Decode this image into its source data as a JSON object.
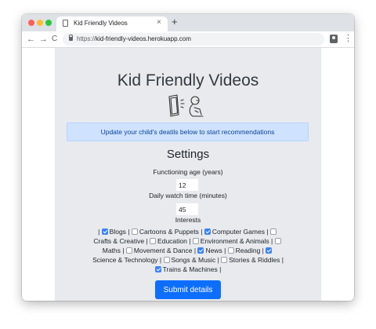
{
  "browser": {
    "tab_title": "Kid Friendly Videos",
    "tab_close": "×",
    "new_tab": "+",
    "url_protocol": "https://",
    "url_host": "kid-friendly-videos.herokuapp.com",
    "back": "←",
    "forward": "→",
    "reload": "C",
    "menu": "⋮"
  },
  "page": {
    "title": "Kid Friendly Videos",
    "alert": "Update your child's deatils below to start recommendations",
    "settings_heading": "Settings",
    "age_label": "Functioning age (years)",
    "age_value": "12",
    "watch_label": "Daily watch time (minutes)",
    "watch_value": "45",
    "interests_label": "Interests",
    "interests": [
      {
        "label": "Blogs",
        "checked": true
      },
      {
        "label": "Cartoons & Puppets",
        "checked": false
      },
      {
        "label": "Computer Games",
        "checked": true
      },
      {
        "label": "Crafts & Creative",
        "checked": false
      },
      {
        "label": "Education",
        "checked": false
      },
      {
        "label": "Environment & Animals",
        "checked": false
      },
      {
        "label": "Maths",
        "checked": false
      },
      {
        "label": "Movement & Dance",
        "checked": false
      },
      {
        "label": "News",
        "checked": true
      },
      {
        "label": "Reading",
        "checked": false
      },
      {
        "label": "Science & Technology",
        "checked": true
      },
      {
        "label": "Songs & Music",
        "checked": false
      },
      {
        "label": "Stories & Riddles",
        "checked": false
      },
      {
        "label": "Trains & Machines",
        "checked": true
      }
    ],
    "submit_label": "Submit details"
  },
  "colors": {
    "accent": "#0d6efd",
    "alert_bg": "#cfe2ff",
    "panel_bg": "#e8eaee"
  }
}
